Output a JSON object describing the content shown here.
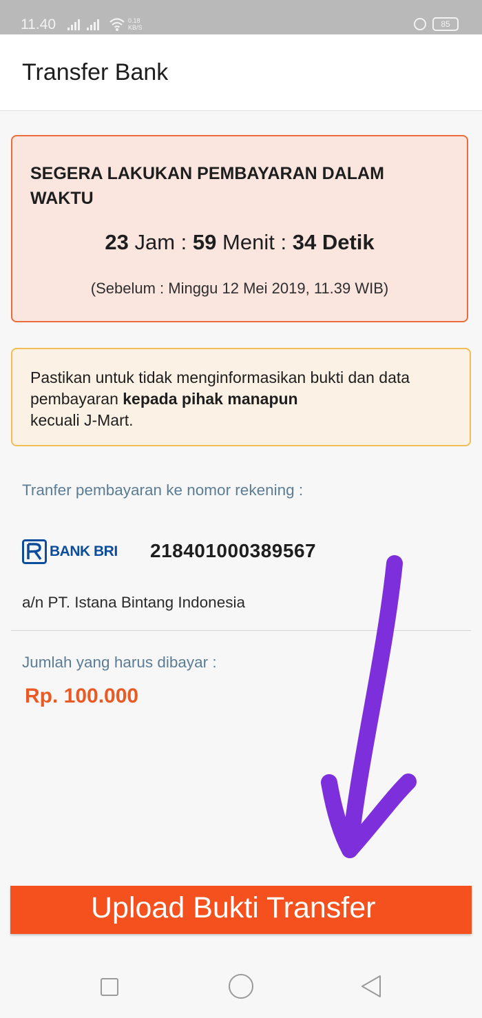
{
  "status_bar": {
    "time": "11.40",
    "net_speed": "0.18",
    "net_unit": "KB/S",
    "battery": "85"
  },
  "app_bar": {
    "title": "Transfer Bank"
  },
  "timer_card": {
    "heading": "SEGERA LAKUKAN PEMBAYARAN DALAM WAKTU",
    "hours": "23",
    "hours_unit": "Jam",
    "sep": ":",
    "minutes": "59",
    "minutes_unit": "Menit",
    "seconds": "34",
    "seconds_unit": "Detik",
    "deadline": "(Sebelum : Minggu 12 Mei 2019, 11.39 WIB)"
  },
  "warning_card": {
    "text_before": "Pastikan untuk tidak menginformasikan bukti dan data pembayaran",
    "text_bold": "kepada pihak manapun",
    "text_after": "kecuali J-Mart."
  },
  "transfer": {
    "label": "Tranfer pembayaran ke nomor rekening :",
    "bank_name": "BANK BRI",
    "account_number": "218401000389567",
    "account_holder": "a/n PT. Istana Bintang Indonesia"
  },
  "payment": {
    "label": "Jumlah yang harus dibayar :",
    "amount": "Rp. 100.000"
  },
  "upload_button": {
    "label": "Upload Bukti Transfer"
  },
  "icons": {
    "arrow": "purple-hand-drawn-arrow-icon",
    "nav": [
      "recent-apps-icon",
      "home-icon",
      "back-icon"
    ]
  },
  "colors": {
    "accent": "#f5511e",
    "amount": "#ea5a25",
    "bank_blue": "#0c4c9c",
    "arrow": "#7e2fdc",
    "timer_border": "#ec6b3a",
    "warning_border": "#f2bd52"
  }
}
